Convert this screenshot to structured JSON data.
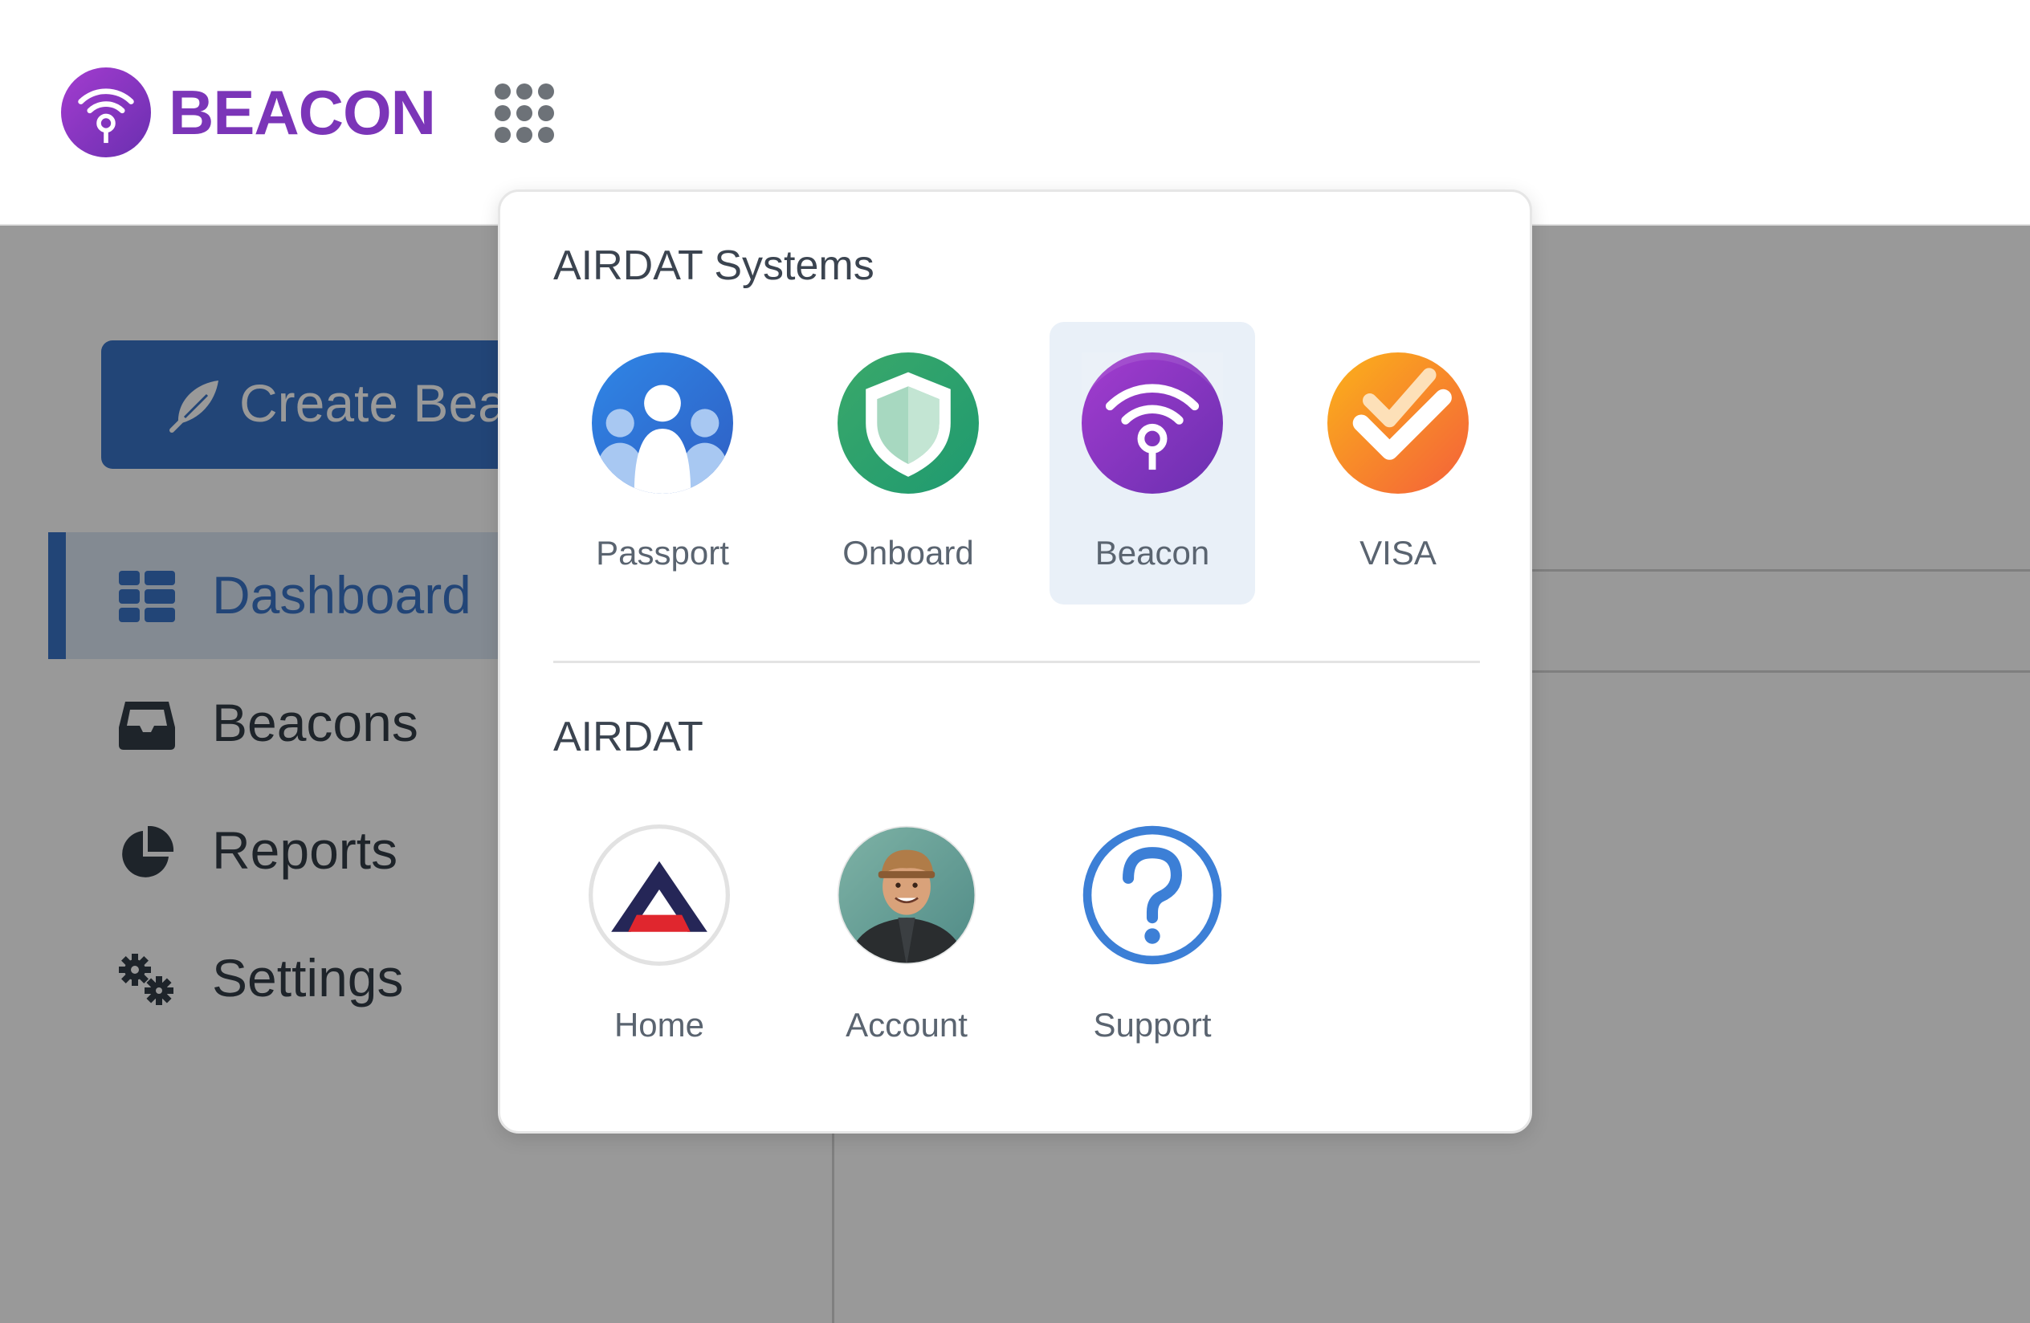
{
  "header": {
    "brand": "BEACON",
    "logo_icon": "beacon-logo-icon",
    "apps_icon": "apps-grid-icon",
    "brand_color": "#7b35b8"
  },
  "sidebar": {
    "create_button_label": "Create Bea",
    "create_button_icon": "feather-icon",
    "items": [
      {
        "label": "Dashboard",
        "icon": "dashboard-icon",
        "active": true
      },
      {
        "label": "Beacons",
        "icon": "inbox-icon",
        "active": false
      },
      {
        "label": "Reports",
        "icon": "pie-chart-icon",
        "active": false
      },
      {
        "label": "Settings",
        "icon": "gears-icon",
        "active": false
      }
    ],
    "accent_color": "#3a74c6"
  },
  "launcher": {
    "systems_title": "AIRDAT Systems",
    "systems": [
      {
        "label": "Passport",
        "icon": "passport-icon",
        "selected": false
      },
      {
        "label": "Onboard",
        "icon": "onboard-shield-icon",
        "selected": false
      },
      {
        "label": "Beacon",
        "icon": "beacon-icon",
        "selected": true
      },
      {
        "label": "VISA",
        "icon": "visa-check-icon",
        "selected": false
      }
    ],
    "airdat_title": "AIRDAT",
    "airdat": [
      {
        "label": "Home",
        "icon": "airdat-home-icon"
      },
      {
        "label": "Account",
        "icon": "account-avatar"
      },
      {
        "label": "Support",
        "icon": "support-question-icon"
      }
    ]
  }
}
